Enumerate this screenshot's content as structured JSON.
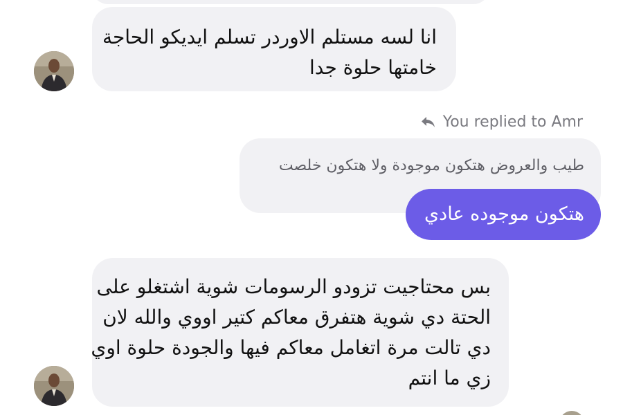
{
  "conversation": {
    "messages": [
      {
        "lines": [
          "انا لسه مستلم الاوردر تسلم ايديكو الحاجة",
          "خامتها حلوة جدا"
        ]
      },
      {
        "reply_note": "You replied to Amr",
        "quoted": "طيب والعروض هتكون موجودة ولا هتكون خلصت",
        "text": "هتكون موجوده عادي"
      },
      {
        "lines": [
          "بس محتاجيت تزودو الرسومات شوية اشتغلو على",
          "الحتة دي شوية هتفرق معاكم كتير اووي والله لان",
          "دي تالت مرة اتغامل معاكم فيها والجودة حلوة اوي",
          "زي ما انتم"
        ]
      }
    ]
  },
  "colors": {
    "incoming_bubble": "#f1f1f4",
    "outgoing_bubble": "#6c5ce7",
    "reply_note_text": "#7a7a80"
  },
  "icons": {
    "reply": "reply-arrow-icon",
    "avatar": "user-avatar"
  }
}
